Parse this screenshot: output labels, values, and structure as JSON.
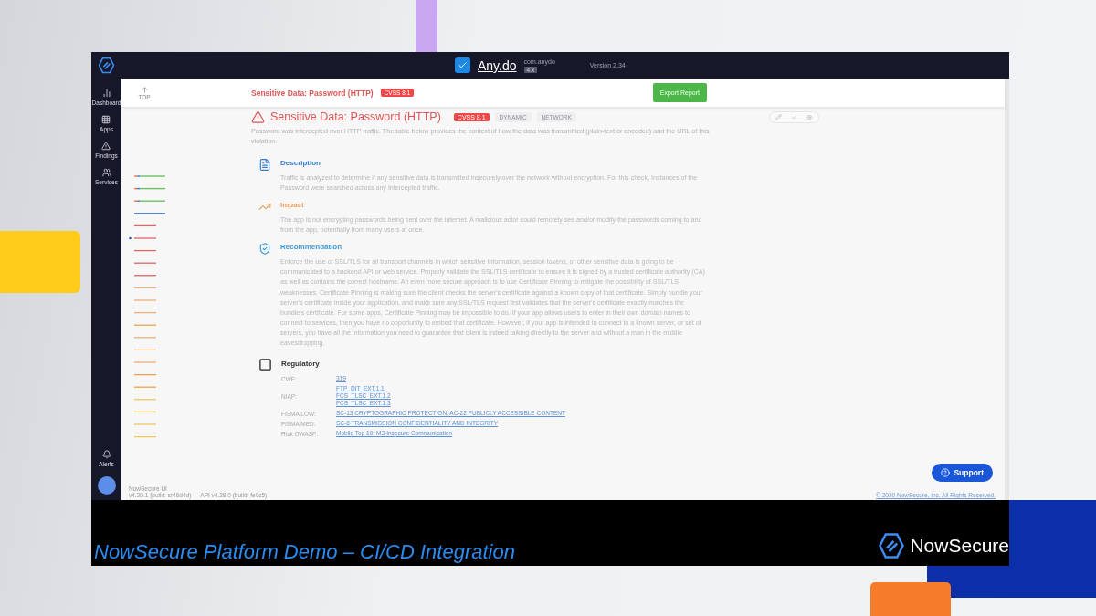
{
  "topbar": {
    "app_name": "Any.do",
    "package": "com.anydo",
    "platform_tag": "4.x",
    "version": "Version 2.34"
  },
  "nav": [
    {
      "label": "Dashboard"
    },
    {
      "label": "Apps"
    },
    {
      "label": "Findings"
    },
    {
      "label": "Services"
    }
  ],
  "nav_bottom": {
    "label": "Alerts"
  },
  "header": {
    "top_label": "TOP",
    "title": "Sensitive Data: Password (HTTP)",
    "badge": "CVSS 8.1",
    "button": "Export Report"
  },
  "finding": {
    "title": "Sensitive Data: Password (HTTP)",
    "badge": "CVSS 8.1",
    "tags": [
      "DYNAMIC",
      "NETWORK"
    ],
    "summary": "Password was intercepted over HTTP traffic. The table below provides the context of how the data was transmitted (plain-text or encoded) and the URL of this violation.",
    "sections": [
      {
        "kind": "description",
        "title": "Description",
        "text": "Traffic is analyzed to determine if any sensitive data is transmitted insecurely over the network without encryption. For this check, Instances of the Password were searched across any Intercepted traffic."
      },
      {
        "kind": "impact",
        "title": "Impact",
        "text": "The app is not encrypting passwords being sent over the internet. A malicious actor could remotely see and/or modify the passwords coming to and from the app, potentially from many users at once."
      },
      {
        "kind": "recommendation",
        "title": "Recommendation",
        "text": "Enforce the use of SSL/TLS for all transport channels in which sensitive information, session tokens, or other sensitive data is going to be communicated to a backend API or web service. Properly validate the SSL/TLS certificate to ensure it is signed by a trusted certificate authority (CA) as well as contains the correct hostname. An even more secure approach is to use Certificate Pinning to mitigate the possibility of SSL/TLS weaknesses. Certificate Pinning is making sure the client checks the server's certificate against a known copy of that certificate. Simply bundle your server's certificate inside your application, and make sure any SSL/TLS request first validates that the server's certificate exactly matches the bundle's certificate. For some apps, Certificate Pinning may be impossible to do. If your app allows users to enter in their own domain names to connect to services, then you have no opportunity to embed that certificate. However, if your app is intended to connect to a known server, or set of servers, you have all the information you need to guarantee that client is indeed talking directly to the server and without a man in the middle eavesdropping."
      }
    ],
    "regulatory": {
      "title": "Regulatory",
      "rows": [
        {
          "label": "CWE:",
          "links": [
            "319"
          ]
        },
        {
          "label": "NIAP:",
          "links": [
            "FTP_DIT_EXT.1.1",
            "FCS_TLSC_EXT.1.2",
            "FCS_TLSC_EXT.1.3"
          ]
        },
        {
          "label": "FISMA LOW:",
          "links": [
            "SC-13 CRYPTOGRAPHIC PROTECTION, AC-22 PUBLICLY ACCESSIBLE CONTENT"
          ]
        },
        {
          "label": "FISMA MED:",
          "links": [
            "SC-8 TRANSMISSION CONFIDENTIALITY AND INTEGRITY"
          ]
        },
        {
          "label": "Risk OWASP:",
          "links": [
            "Mobile Top 10: M3-Insecure Communication"
          ]
        }
      ]
    }
  },
  "footer": {
    "product": "NowSecure UI",
    "build": "v4.20.1 (build: sr46d4d)",
    "api": "API v4.28.0 (build: fe0c5)",
    "copyright": "© 2020 NowSecure, Inc. All Rights Reserved."
  },
  "support_button": "Support",
  "caption": "NowSecure Platform Demo – CI/CD Integration",
  "brand": "NowSecure"
}
